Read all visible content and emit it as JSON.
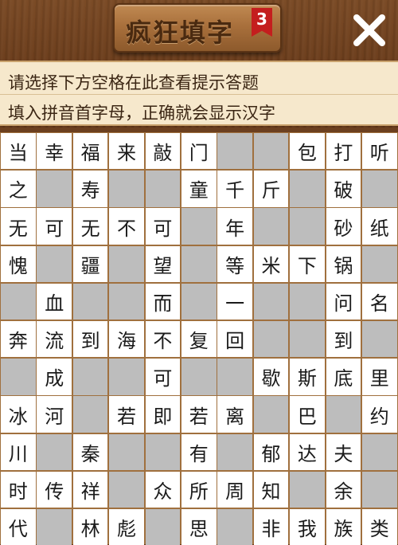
{
  "header": {
    "title": "疯狂填字",
    "level": "3",
    "close_icon": "close-icon"
  },
  "hint": {
    "line1": "请选择下方空格在此查看提示答题",
    "line2": "填入拼音首字母，正确就会显示汉字"
  },
  "colors": {
    "open_cell": "#ffffff",
    "blocked_cell": "#bdbdbd",
    "grid_lines": "#a0703e",
    "hint_background": "#f6e8cc",
    "level_badge": "#c41e1e"
  },
  "grid": {
    "rows": [
      [
        "当",
        "幸",
        "福",
        "来",
        "敲",
        "门",
        null,
        null,
        "包",
        "打",
        "听"
      ],
      [
        "之",
        null,
        "寿",
        null,
        null,
        "童",
        "千",
        "斤",
        null,
        "破",
        null
      ],
      [
        "无",
        "可",
        "无",
        "不",
        "可",
        null,
        "年",
        null,
        null,
        "砂",
        "纸"
      ],
      [
        "愧",
        null,
        "疆",
        null,
        "望",
        null,
        "等",
        "米",
        "下",
        "锅",
        null
      ],
      [
        null,
        "血",
        null,
        null,
        "而",
        null,
        "一",
        null,
        null,
        "问",
        "名"
      ],
      [
        "奔",
        "流",
        "到",
        "海",
        "不",
        "复",
        "回",
        null,
        null,
        "到",
        null
      ],
      [
        null,
        "成",
        null,
        null,
        "可",
        null,
        null,
        "歇",
        "斯",
        "底",
        "里"
      ],
      [
        "冰",
        "河",
        null,
        "若",
        "即",
        "若",
        "离",
        null,
        "巴",
        null,
        "约"
      ],
      [
        "川",
        null,
        "秦",
        null,
        null,
        "有",
        null,
        "郁",
        "达",
        "夫",
        null
      ],
      [
        "时",
        "传",
        "祥",
        null,
        "众",
        "所",
        "周",
        "知",
        null,
        "余",
        null
      ],
      [
        "代",
        null,
        "林",
        "彪",
        null,
        "思",
        null,
        "非",
        "我",
        "族",
        "类"
      ]
    ]
  }
}
